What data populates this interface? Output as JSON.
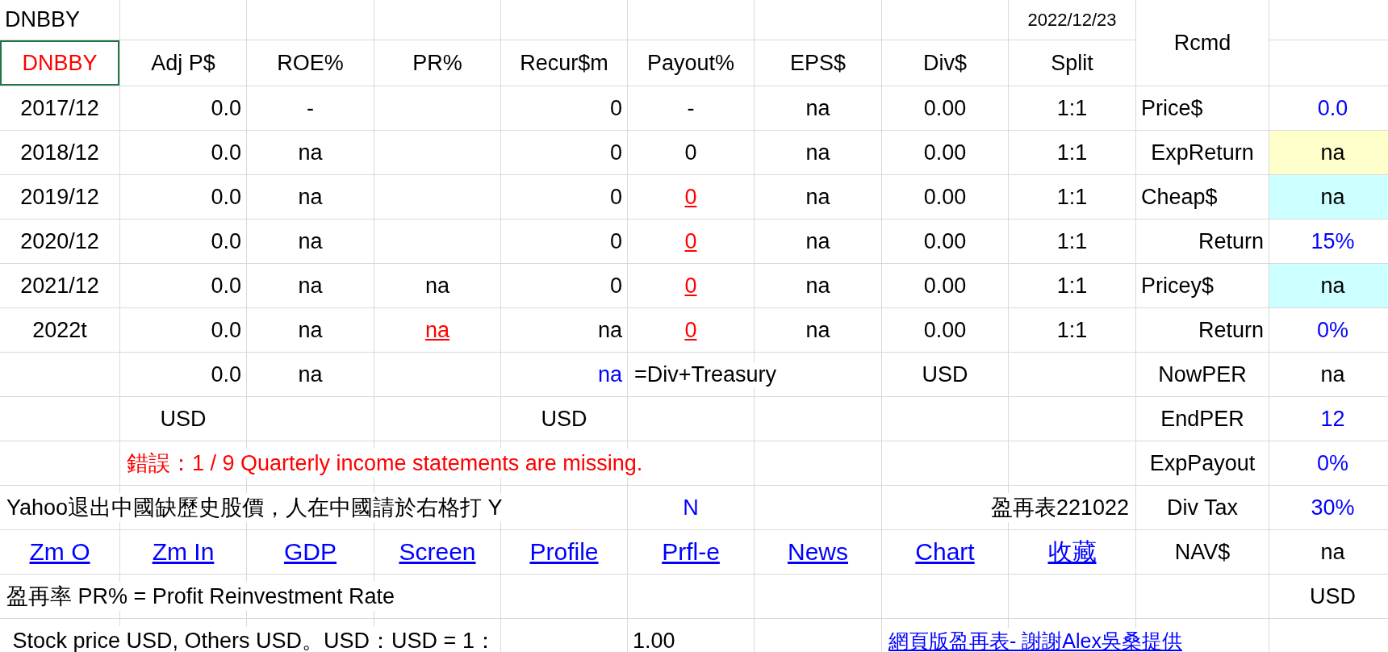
{
  "sheet": {
    "rows": [
      {
        "cells": [
          {
            "text": "DNBBY",
            "kind": "plain",
            "selected": false
          },
          "",
          "",
          "",
          "",
          "",
          "",
          "",
          {
            "text": "2022/12/23",
            "kind": "small",
            "selected": false
          },
          {
            "text": "Rcmd",
            "kind": "plain",
            "selected": false
          },
          ""
        ]
      },
      {
        "cells": [
          {
            "text": "DNBBY",
            "kind": "red",
            "selected": true
          },
          {
            "text": "Adj P$",
            "kind": "plain",
            "selected": false
          },
          {
            "text": "ROE%",
            "kind": "plain",
            "selected": false
          },
          {
            "text": "PR%",
            "kind": "plain",
            "selected": false
          },
          {
            "text": "Recur$m",
            "kind": "plain",
            "selected": false
          },
          {
            "text": "Payout%",
            "kind": "plain",
            "selected": false
          },
          {
            "text": "EPS$",
            "kind": "plain",
            "selected": false
          },
          {
            "text": "Div$",
            "kind": "plain",
            "selected": false
          },
          {
            "text": "Split",
            "kind": "plain",
            "selected": false
          },
          ""
        ]
      },
      {
        "cells": [
          {
            "text": "2017/12",
            "kind": "plain",
            "selected": false
          },
          {
            "text": "0.0",
            "kind": "plain",
            "selected": false
          },
          {
            "text": "-",
            "kind": "plain",
            "selected": false
          },
          "",
          {
            "text": "0",
            "kind": "plain",
            "selected": false
          },
          {
            "text": "-",
            "kind": "plain",
            "selected": false
          },
          {
            "text": "na",
            "kind": "plain",
            "selected": false
          },
          {
            "text": "0.00",
            "kind": "plain",
            "selected": false
          },
          {
            "text": "1:1",
            "kind": "plain",
            "selected": false
          },
          {
            "text": "Price$",
            "kind": "plain",
            "selected": false
          },
          {
            "text": "0.0",
            "kind": "blue",
            "selected": false
          }
        ]
      },
      {
        "cells": [
          {
            "text": "2018/12",
            "kind": "plain",
            "selected": false
          },
          {
            "text": "0.0",
            "kind": "plain",
            "selected": false
          },
          {
            "text": "na",
            "kind": "plain",
            "selected": false
          },
          "",
          {
            "text": "0",
            "kind": "plain",
            "selected": false
          },
          {
            "text": "0",
            "kind": "plain",
            "selected": false
          },
          {
            "text": "na",
            "kind": "plain",
            "selected": false
          },
          {
            "text": "0.00",
            "kind": "plain",
            "selected": false
          },
          {
            "text": "1:1",
            "kind": "plain",
            "selected": false
          },
          {
            "text": "ExpReturn",
            "kind": "plain",
            "selected": false
          },
          {
            "text": "na",
            "kind": "plain",
            "color": "#ffffcc",
            "selected": false
          }
        ]
      },
      {
        "cells": [
          {
            "text": "2019/12",
            "kind": "plain",
            "selected": false
          },
          {
            "text": "0.0",
            "kind": "plain",
            "selected": false
          },
          {
            "text": "na",
            "kind": "plain",
            "selected": false
          },
          "",
          {
            "text": "0",
            "kind": "plain",
            "selected": false
          },
          {
            "text": "0",
            "kind": "redlink",
            "selected": false
          },
          {
            "text": "na",
            "kind": "plain",
            "selected": false
          },
          {
            "text": "0.00",
            "kind": "plain",
            "selected": false
          },
          {
            "text": "1:1",
            "kind": "plain",
            "selected": false
          },
          {
            "text": "Cheap$",
            "kind": "plain",
            "selected": false
          },
          {
            "text": "na",
            "kind": "plain",
            "color": "#ccffff",
            "selected": false
          }
        ]
      },
      {
        "cells": [
          {
            "text": "2020/12",
            "kind": "plain",
            "selected": false
          },
          {
            "text": "0.0",
            "kind": "plain",
            "selected": false
          },
          {
            "text": "na",
            "kind": "plain",
            "selected": false
          },
          "",
          {
            "text": "0",
            "kind": "plain",
            "selected": false
          },
          {
            "text": "0",
            "kind": "redlink",
            "selected": false
          },
          {
            "text": "na",
            "kind": "plain",
            "selected": false
          },
          {
            "text": "0.00",
            "kind": "plain",
            "selected": false
          },
          {
            "text": "1:1",
            "kind": "plain",
            "selected": false
          },
          {
            "text": "Return",
            "kind": "plain",
            "selected": false
          },
          {
            "text": "15%",
            "kind": "blue",
            "selected": false
          }
        ]
      },
      {
        "cells": [
          {
            "text": "2021/12",
            "kind": "plain",
            "selected": false
          },
          {
            "text": "0.0",
            "kind": "plain",
            "selected": false
          },
          {
            "text": "na",
            "kind": "plain",
            "selected": false
          },
          {
            "text": "na",
            "kind": "plain",
            "selected": false
          },
          {
            "text": "0",
            "kind": "plain",
            "selected": false
          },
          {
            "text": "0",
            "kind": "redlink",
            "selected": false
          },
          {
            "text": "na",
            "kind": "plain",
            "selected": false
          },
          {
            "text": "0.00",
            "kind": "plain",
            "selected": false
          },
          {
            "text": "1:1",
            "kind": "plain",
            "selected": false
          },
          {
            "text": "Pricey$",
            "kind": "plain",
            "selected": false
          },
          {
            "text": "na",
            "kind": "plain",
            "color": "#ccffff",
            "selected": false
          }
        ]
      },
      {
        "cells": [
          {
            "text": "2022t",
            "kind": "plain",
            "selected": false
          },
          {
            "text": "0.0",
            "kind": "plain",
            "selected": false
          },
          {
            "text": "na",
            "kind": "plain",
            "selected": false
          },
          {
            "text": "na",
            "kind": "redlink",
            "selected": false
          },
          {
            "text": "na",
            "kind": "plain",
            "selected": false
          },
          {
            "text": "0",
            "kind": "redlink",
            "selected": false
          },
          {
            "text": "na",
            "kind": "plain",
            "selected": false
          },
          {
            "text": "0.00",
            "kind": "plain",
            "selected": false
          },
          {
            "text": "1:1",
            "kind": "plain",
            "selected": false
          },
          {
            "text": "Return",
            "kind": "plain",
            "selected": false
          },
          {
            "text": "0%",
            "kind": "blue",
            "selected": false
          }
        ]
      },
      {
        "cells": [
          "",
          {
            "text": "0.0",
            "kind": "plain",
            "selected": false
          },
          {
            "text": "na",
            "kind": "plain",
            "selected": false
          },
          "",
          {
            "text": "na",
            "kind": "blue",
            "selected": false
          },
          {
            "text": "=Div+Treasury",
            "kind": "plain",
            "selected": false
          },
          "",
          {
            "text": "USD",
            "kind": "plain",
            "selected": false
          },
          "",
          {
            "text": "NowPER",
            "kind": "plain",
            "selected": false
          },
          {
            "text": "na",
            "kind": "plain",
            "selected": false
          }
        ]
      },
      {
        "cells": [
          "",
          {
            "text": "USD",
            "kind": "plain",
            "selected": false
          },
          "",
          "",
          {
            "text": "USD",
            "kind": "plain",
            "selected": false
          },
          "",
          "",
          "",
          "",
          {
            "text": "EndPER",
            "kind": "plain",
            "selected": false
          },
          {
            "text": "12",
            "kind": "blue",
            "selected": false
          }
        ]
      },
      {
        "cells": [
          "",
          {
            "text": "錯誤：1 / 9 Quarterly income statements are missing.",
            "kind": "red",
            "selected": false
          },
          "",
          "",
          "",
          "",
          "",
          "",
          "",
          {
            "text": "ExpPayout",
            "kind": "plain",
            "selected": false
          },
          {
            "text": "0%",
            "kind": "blue",
            "selected": false
          }
        ]
      },
      {
        "cells": [
          {
            "text": "Yahoo退出中國缺歷史股價，人在中國請於右格打 Y",
            "kind": "plain",
            "selected": false
          },
          "",
          "",
          "",
          "",
          {
            "text": "N",
            "kind": "blue",
            "selected": false
          },
          "",
          "",
          {
            "text": "盈再表221022",
            "kind": "plain",
            "selected": false
          },
          {
            "text": "Div Tax",
            "kind": "plain",
            "selected": false
          },
          {
            "text": "30%",
            "kind": "blue",
            "selected": false
          }
        ]
      },
      {
        "cells": [
          {
            "text": "Zm O",
            "kind": "link",
            "selected": false
          },
          {
            "text": "Zm In",
            "kind": "link",
            "selected": false
          },
          {
            "text": "GDP",
            "kind": "link",
            "selected": false
          },
          {
            "text": "Screen",
            "kind": "link",
            "selected": false
          },
          {
            "text": "Profile",
            "kind": "link",
            "selected": false
          },
          {
            "text": "Prfl-e",
            "kind": "link",
            "selected": false
          },
          {
            "text": "News",
            "kind": "link",
            "selected": false
          },
          {
            "text": "Chart",
            "kind": "link",
            "selected": false
          },
          {
            "text": "收藏",
            "kind": "link",
            "selected": false
          },
          {
            "text": "NAV$",
            "kind": "plain",
            "selected": false
          },
          {
            "text": "na",
            "kind": "plain",
            "selected": false
          }
        ]
      },
      {
        "cells": [
          {
            "text": "盈再率 PR% = Profit Reinvestment Rate",
            "kind": "plain",
            "selected": false
          },
          "",
          "",
          "",
          "",
          "",
          "",
          "",
          "",
          "",
          {
            "text": "USD",
            "kind": "plain",
            "selected": false
          }
        ]
      },
      {
        "cells": [
          {
            "text": " Stock price USD, Others USD。USD：USD = 1：",
            "kind": "plain",
            "selected": false
          },
          "",
          "",
          "",
          "",
          {
            "text": "1.00",
            "kind": "plain",
            "selected": false
          },
          "",
          {
            "text": "網頁版盈再表- 謝謝Alex吳桑提供",
            "kind": "smalllink",
            "selected": false
          },
          "",
          "",
          ""
        ]
      }
    ]
  }
}
